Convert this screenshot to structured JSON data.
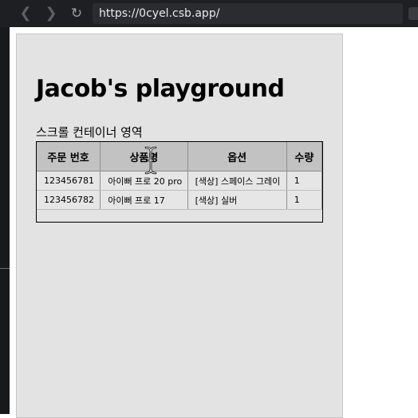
{
  "browser": {
    "url": "https://0cyel.csb.app/",
    "back_icon": "chevron-left-icon",
    "forward_icon": "chevron-right-icon",
    "reload_icon": "reload-icon"
  },
  "page": {
    "title": "Jacob's playground",
    "section_label": "스크롤 컨테이너 영역"
  },
  "table": {
    "headers": [
      "주문 번호",
      "상품명",
      "옵션",
      "수량"
    ],
    "rows": [
      [
        "123456781",
        "아이뻐 프로 20 pro",
        "[색상] 스페이스 그레이",
        "1"
      ],
      [
        "123456782",
        "아이뻐 프로 17",
        "[색상] 실버",
        "1"
      ]
    ]
  },
  "colors": {
    "browser_bar": "#1e1f22",
    "container_bg": "#e3e3e3",
    "header_bg": "#c2c2c2"
  }
}
